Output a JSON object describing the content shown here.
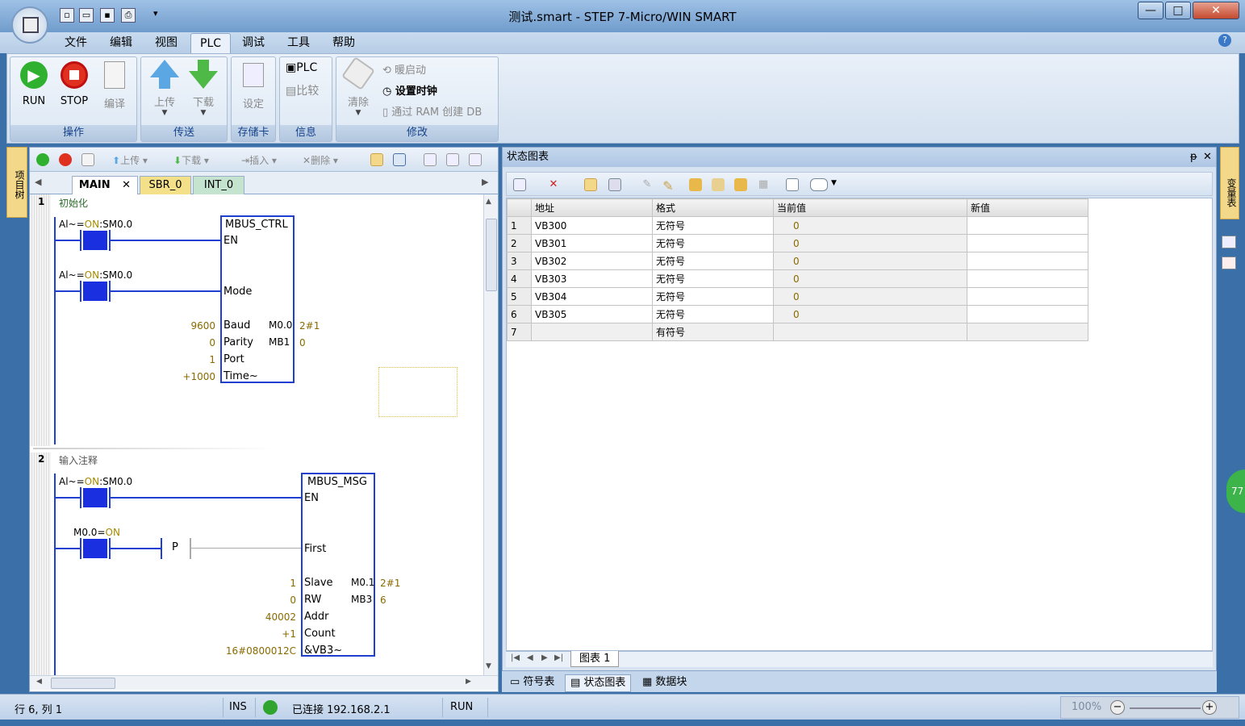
{
  "window": {
    "title": "测试.smart - STEP 7-Micro/WIN SMART",
    "minimize": "—",
    "maximize": "□",
    "close": "✕"
  },
  "menu": [
    "文件",
    "编辑",
    "视图",
    "PLC",
    "调试",
    "工具",
    "帮助"
  ],
  "ribbon": {
    "groups": {
      "ops": "操作",
      "transfer": "传送",
      "card": "存储卡",
      "info": "信息",
      "modify": "修改"
    },
    "run": "RUN",
    "stop": "STOP",
    "compile": "编译",
    "upload": "上传",
    "download": "下载",
    "set": "设定",
    "plc": "PLC",
    "compare": "比较",
    "clear": "清除",
    "warm": "暖启动",
    "settime": "设置时钟",
    "ramdb": "通过 RAM 创建 DB"
  },
  "left_strip": "项目树",
  "right_strip": "变量表",
  "editor": {
    "toolbar": {
      "upload": "上传",
      "download": "下载",
      "insert": "插入",
      "delete": "删除"
    },
    "tabs": [
      "MAIN",
      "SBR_0",
      "INT_0"
    ],
    "network1": {
      "num": "1",
      "comment": "初始化",
      "c1_prefix": "Al~=",
      "c1_on": "ON",
      "c1_suffix": ":SM0.0",
      "c2_prefix": "Al~=",
      "c2_on": "ON",
      "c2_suffix": ":SM0.0",
      "box": "MBUS_CTRL",
      "en": "EN",
      "mode": "Mode",
      "baud": "Baud",
      "parity": "Parity",
      "port": "Port",
      "time": "Time~",
      "baud_v": "9600",
      "parity_v": "0",
      "port_v": "1",
      "time_v": "+1000",
      "done": "M0.0",
      "done_v": "2#1",
      "error": "MB1",
      "error_v": "0"
    },
    "network2": {
      "num": "2",
      "comment": "输入注释",
      "c1_prefix": "Al~=",
      "c1_on": "ON",
      "c1_suffix": ":SM0.0",
      "c2_prefix": "M0.0=",
      "c2_on": "ON",
      "p": "P",
      "box": "MBUS_MSG",
      "en": "EN",
      "first": "First",
      "slave": "Slave",
      "rw": "RW",
      "addr": "Addr",
      "count": "Count",
      "dataptr": "&VB3~",
      "slave_v": "1",
      "rw_v": "0",
      "addr_v": "40002",
      "count_v": "+1",
      "dataptr_v": "16#0800012C",
      "done": "M0.1",
      "done_v": "2#1",
      "error": "MB3",
      "error_v": "6"
    }
  },
  "status_chart": {
    "title": "状态图表",
    "pin": "ᵽ",
    "close": "✕",
    "columns": [
      "地址",
      "格式",
      "当前值",
      "新值"
    ],
    "rows": [
      {
        "n": "1",
        "addr": "VB300",
        "fmt": "无符号",
        "cur": "0",
        "new": ""
      },
      {
        "n": "2",
        "addr": "VB301",
        "fmt": "无符号",
        "cur": "0",
        "new": ""
      },
      {
        "n": "3",
        "addr": "VB302",
        "fmt": "无符号",
        "cur": "0",
        "new": ""
      },
      {
        "n": "4",
        "addr": "VB303",
        "fmt": "无符号",
        "cur": "0",
        "new": ""
      },
      {
        "n": "5",
        "addr": "VB304",
        "fmt": "无符号",
        "cur": "0",
        "new": ""
      },
      {
        "n": "6",
        "addr": "VB305",
        "fmt": "无符号",
        "cur": "0",
        "new": ""
      },
      {
        "n": "7",
        "addr": "",
        "fmt": "有符号",
        "cur": "",
        "new": ""
      }
    ],
    "sheet_tab": "图表 1"
  },
  "bottom_tabs": [
    "符号表",
    "状态图表",
    "数据块"
  ],
  "status": {
    "pos": "行 6, 列 1",
    "mode": "INS",
    "conn": "已连接 192.168.2.1",
    "state": "RUN",
    "zoom": "100%"
  },
  "colors": {
    "accent": "#1f3fd0",
    "status_ok": "#2fa52f"
  }
}
